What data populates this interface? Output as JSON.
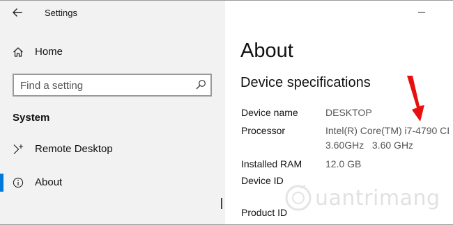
{
  "window": {
    "title": "Settings"
  },
  "nav": {
    "home_label": "Home",
    "search_placeholder": "Find a setting",
    "section_header": "System",
    "items": [
      {
        "label": "Remote Desktop",
        "icon": "remote-desktop-icon"
      },
      {
        "label": "About",
        "icon": "info-icon",
        "selected": true
      }
    ]
  },
  "main": {
    "title": "About",
    "section_title": "Device specifications",
    "specs": [
      {
        "label": "Device name",
        "value": "DESKTOP"
      },
      {
        "label": "Processor",
        "value": "Intel(R) Core(TM) i7-4790 CI",
        "value2": "3.60GHz   3.60 GHz"
      },
      {
        "label": "Installed RAM",
        "value": "12.0 GB"
      },
      {
        "label": "Device ID",
        "value": ""
      },
      {
        "label": "Product ID",
        "value": ""
      }
    ]
  },
  "annotation": {
    "arrow_color": "#e8100e"
  },
  "watermark": {
    "text": "uantrimang"
  },
  "colors": {
    "accent": "#0078d7",
    "nav_background": "#f2f2f2",
    "content_background": "#ffffff"
  }
}
